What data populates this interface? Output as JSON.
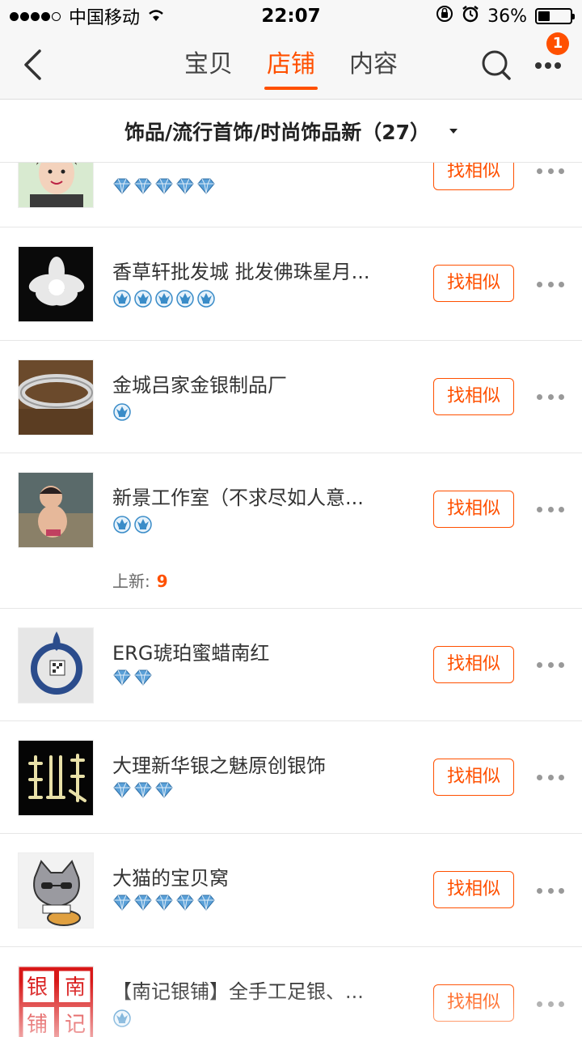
{
  "status_bar": {
    "carrier": "中国移动",
    "time": "22:07",
    "battery": "36%",
    "battery_level": 0.36
  },
  "nav": {
    "tabs": [
      {
        "label": "宝贝",
        "active": false
      },
      {
        "label": "店铺",
        "active": true
      },
      {
        "label": "内容",
        "active": false
      }
    ],
    "badge_count": "1",
    "icons": {
      "back": "back-chevron-icon",
      "search": "search-icon",
      "more": "more-dots-icon"
    }
  },
  "filter": {
    "label": "饰品/流行首饰/时尚饰品新（27）",
    "icon": "caret-down-icon"
  },
  "colors": {
    "accent": "#ff5000",
    "diamond": "#5aa0d8",
    "crown": "#3a8cc8"
  },
  "find_similar_label": "找相似",
  "shops": [
    {
      "name": "",
      "level_type": "diamond",
      "level_count": 5,
      "new_label": "",
      "new_count": ""
    },
    {
      "name": "香草轩批发城 批发佛珠星月...",
      "level_type": "crown",
      "level_count": 5,
      "new_label": "",
      "new_count": ""
    },
    {
      "name": "金城吕家金银制品厂",
      "level_type": "crown",
      "level_count": 1,
      "new_label": "",
      "new_count": ""
    },
    {
      "name": "新景工作室（不求尽如人意...",
      "level_type": "crown",
      "level_count": 2,
      "new_label": "上新:",
      "new_count": "9"
    },
    {
      "name": "ERG琥珀蜜蜡南红",
      "level_type": "diamond",
      "level_count": 2,
      "new_label": "",
      "new_count": ""
    },
    {
      "name": "大理新华银之魅原创银饰",
      "level_type": "diamond",
      "level_count": 3,
      "new_label": "",
      "new_count": ""
    },
    {
      "name": "大猫的宝贝窝",
      "level_type": "diamond",
      "level_count": 5,
      "new_label": "",
      "new_count": ""
    },
    {
      "name": "【南记银铺】全手工足银、...",
      "level_type": "crown",
      "level_count": 1,
      "new_label": "",
      "new_count": ""
    }
  ],
  "thumb_labels": {
    "shop_7": "银南铺记"
  }
}
